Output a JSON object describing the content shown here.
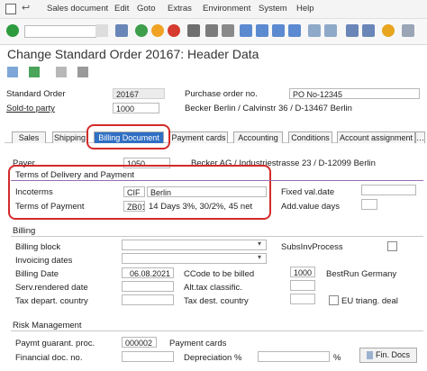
{
  "menubar": {
    "items": [
      "Sales document",
      "Edit",
      "Goto",
      "Extras",
      "Environment",
      "System",
      "Help"
    ]
  },
  "header": {
    "title": "Change Standard Order 20167: Header Data"
  },
  "overview": {
    "standard_order_label": "Standard Order",
    "standard_order_value": "20167",
    "po_label": "Purchase order no.",
    "po_value": "PO No-12345",
    "sold_to_label": "Sold-to party",
    "sold_to_value": "1000",
    "sold_to_name": "Becker Berlin / Calvinstr 36 / D-13467 Berlin"
  },
  "tabs": [
    "Sales",
    "Shipping",
    "Billing Document",
    "Payment cards",
    "Accounting",
    "Conditions",
    "Account assignment"
  ],
  "payer": {
    "label": "Payer",
    "value": "1050",
    "name": "Becker AG / Industriestrasse 23 / D-12099 Berlin"
  },
  "delivery_payment": {
    "title": "Terms of Delivery and Payment",
    "incoterms_label": "Incoterms",
    "incoterms_code": "CIF",
    "incoterms_place": "Berlin",
    "payment_label": "Terms of Payment",
    "payment_code": "ZB01",
    "payment_text": "14 Days 3%, 30/2%, 45 net",
    "fixed_val_label": "Fixed val.date",
    "add_value_label": "Add.value days"
  },
  "billing": {
    "title": "Billing",
    "billing_block_label": "Billing block",
    "subsinv_label": "SubsInvProcess",
    "invoicing_dates_label": "Invoicing dates",
    "billing_date_label": "Billing Date",
    "billing_date_value": "06.08.2021",
    "ccode_label": "CCode to be billed",
    "ccode_value": "1000",
    "ccode_name": "BestRun Germany",
    "serv_label": "Serv.rendered date",
    "alt_tax_label": "Alt.tax classific.",
    "tax_depart_label": "Tax depart. country",
    "tax_dest_label": "Tax dest. country",
    "eu_label": "EU triang. deal"
  },
  "risk": {
    "title": "Risk Management",
    "guarant_label": "Paymt guarant. proc.",
    "guarant_value": "000002",
    "guarant_text": "Payment cards",
    "fin_doc_label": "Financial doc. no.",
    "depreciation_label": "Depreciation %",
    "percent_sign": "%",
    "fin_docs_button": "Fin. Docs"
  }
}
